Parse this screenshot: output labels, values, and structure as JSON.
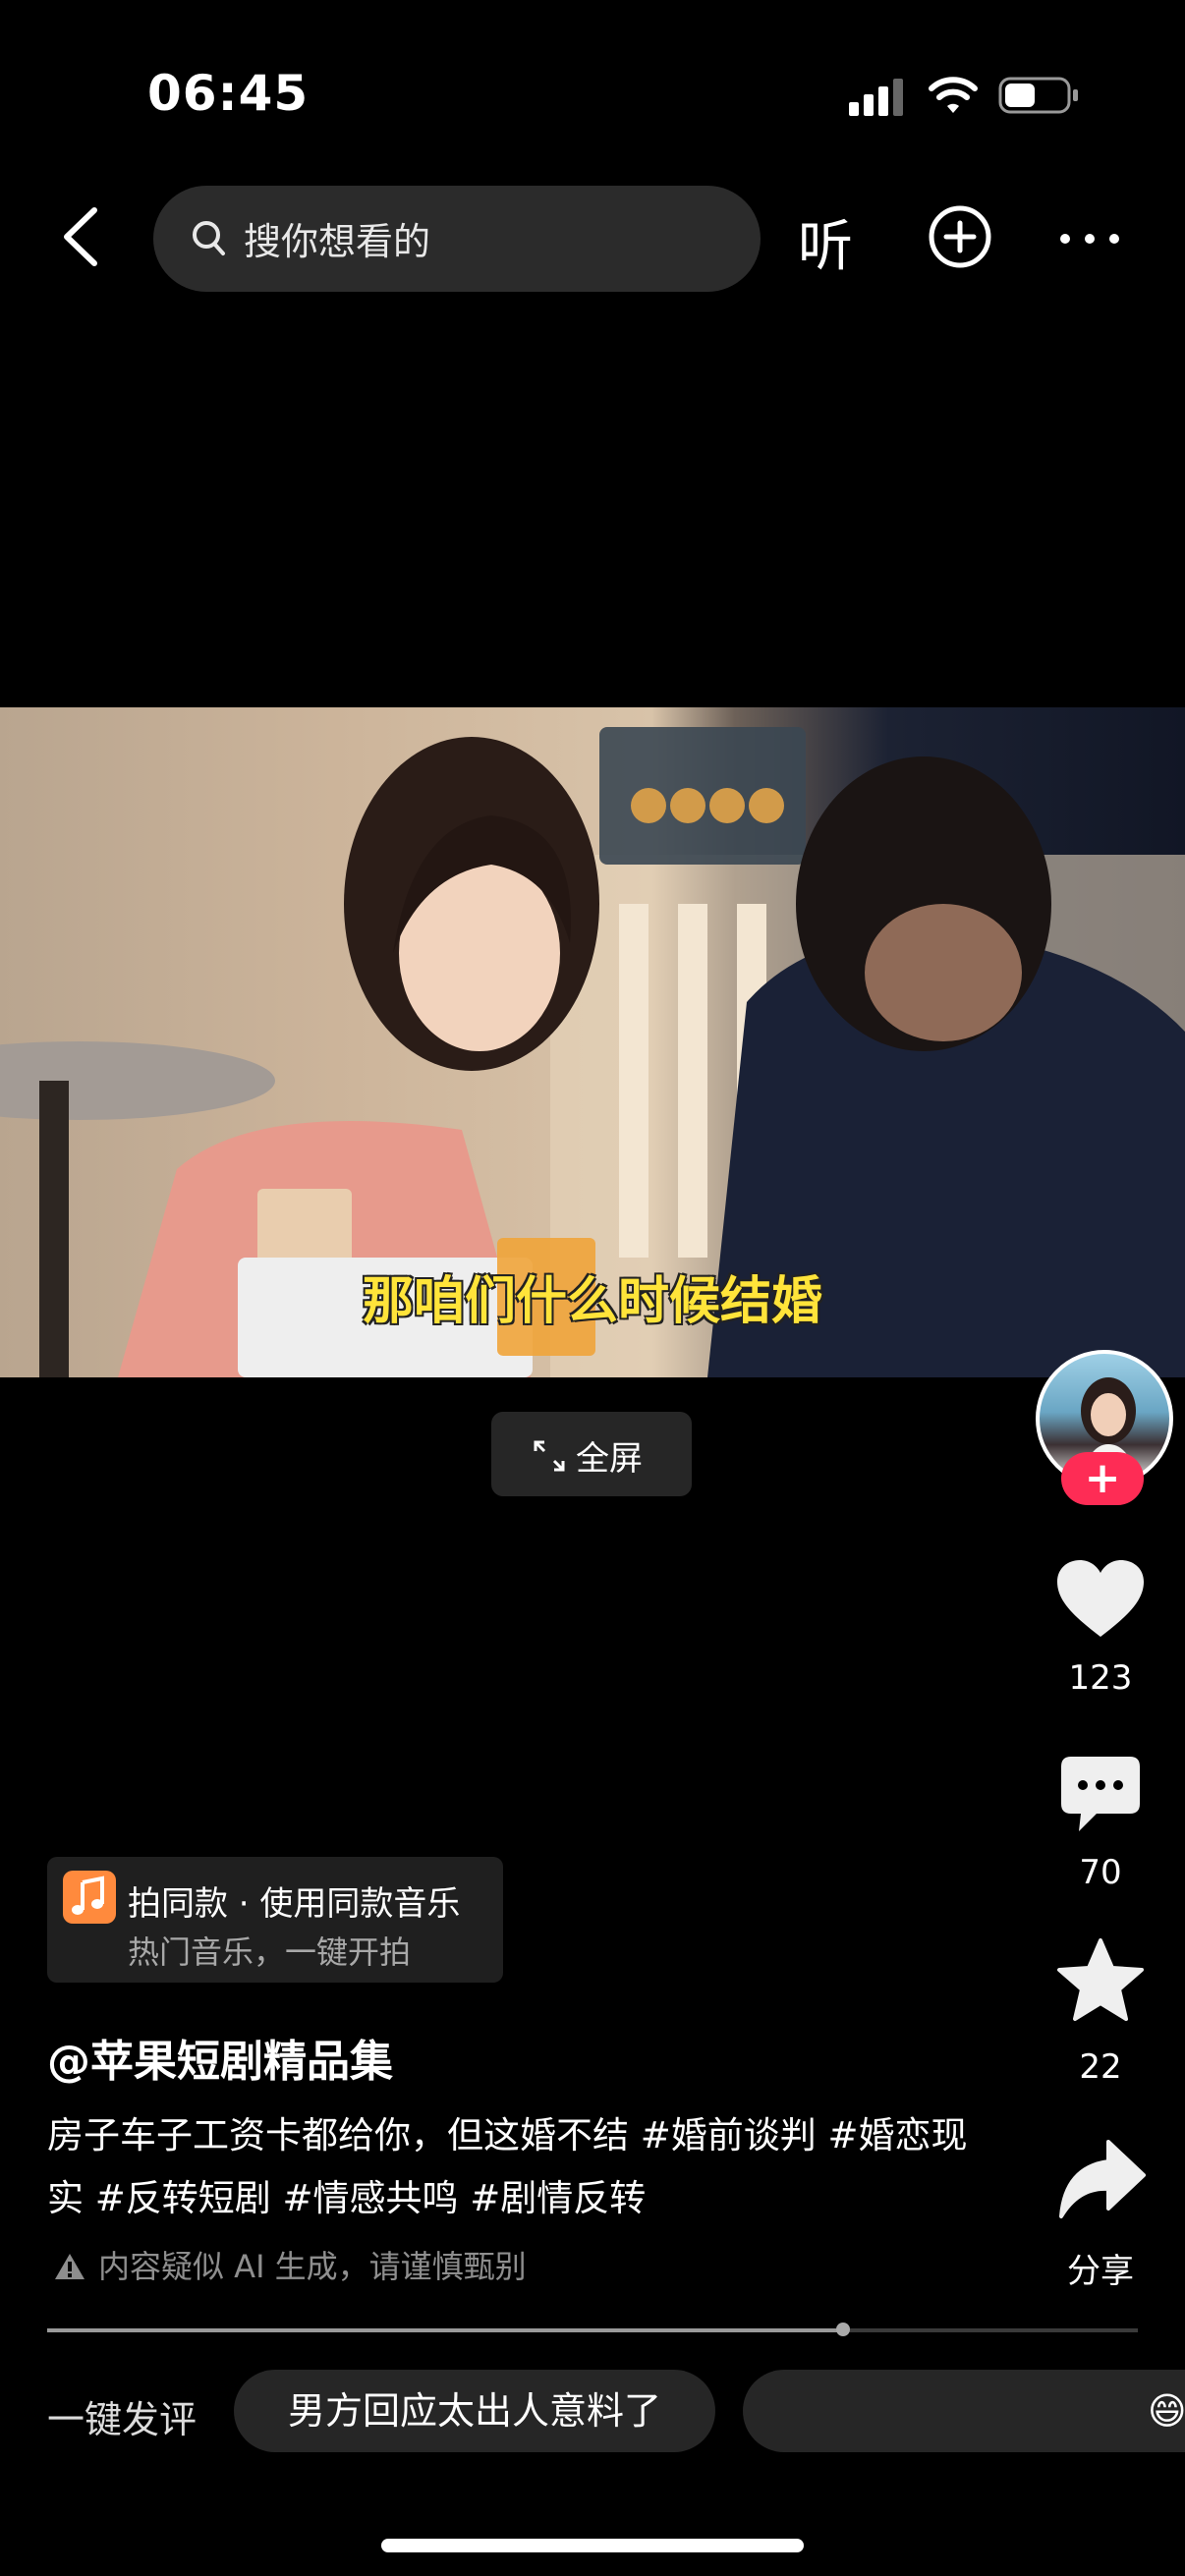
{
  "status_bar": {
    "time": "06:45"
  },
  "top_bar": {
    "search_placeholder": "搜你想看的",
    "listen_label": "听"
  },
  "video": {
    "subtitle": "那咱们什么时候结婚",
    "fullscreen_label": "全屏"
  },
  "right_rail": {
    "likes": "123",
    "comments": "70",
    "favorites": "22",
    "share_label": "分享",
    "follow_symbol": "+"
  },
  "music_card": {
    "title": "拍同款 · 使用同款音乐",
    "subtitle": "热门音乐，一键开拍"
  },
  "post": {
    "author": "@苹果短剧精品集",
    "description": "房子车子工资卡都给你，但这婚不结 #婚前谈判 #婚恋现实 #反转短剧 #情感共鸣 #剧情反转",
    "ai_notice": "内容疑似 AI 生成，请谨慎甄别"
  },
  "playback": {
    "progress_fraction": 0.73
  },
  "quick_comment": {
    "label": "一键发评",
    "suggestions": [
      "男方回应太出人意料了"
    ],
    "chip2_emoji": "😄"
  },
  "colors": {
    "accent_red": "#fe2c55",
    "subtitle_yellow": "#ffe43a"
  }
}
